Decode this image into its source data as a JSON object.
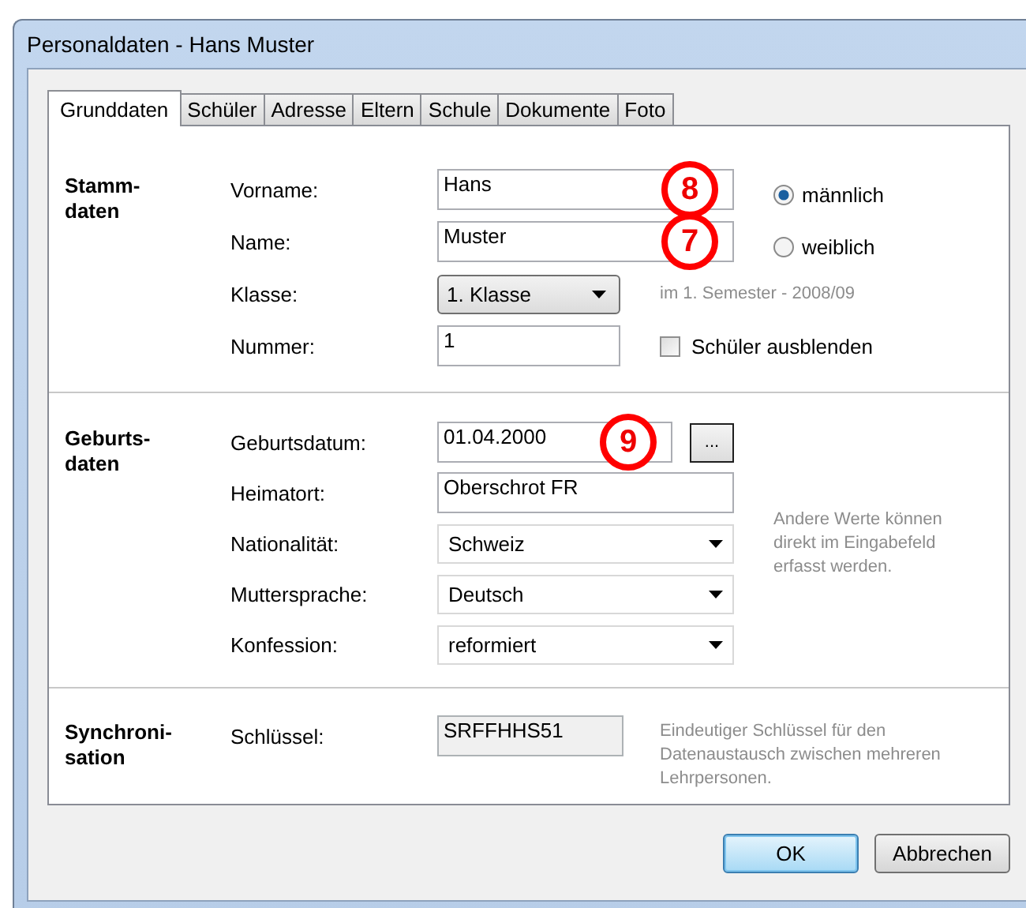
{
  "window": {
    "title": "Personaldaten - Hans Muster"
  },
  "tabs": [
    {
      "label": "Grunddaten",
      "selected": true
    },
    {
      "label": "Schüler",
      "selected": false
    },
    {
      "label": "Adresse",
      "selected": false
    },
    {
      "label": "Eltern",
      "selected": false
    },
    {
      "label": "Schule",
      "selected": false
    },
    {
      "label": "Dokumente",
      "selected": false
    },
    {
      "label": "Foto",
      "selected": false
    }
  ],
  "sections": [
    {
      "title": "Stamm-daten",
      "fields": [
        {
          "label": "Vorname:",
          "kind": "text",
          "value": "Hans",
          "callout": "8",
          "extra": {
            "kind": "radio",
            "label": "männlich",
            "selected": true
          }
        },
        {
          "label": "Name:",
          "kind": "text",
          "value": "Muster",
          "callout": "7",
          "extra": {
            "kind": "radio",
            "label": "weiblich",
            "selected": false
          }
        },
        {
          "label": "Klasse:",
          "kind": "combo",
          "value": "1. Klasse",
          "extra": {
            "kind": "hint",
            "text": "im 1. Semester - 2008/09"
          }
        },
        {
          "label": "Nummer:",
          "kind": "number",
          "value": "1",
          "extra": {
            "kind": "checkbox",
            "label": "Schüler ausblenden",
            "checked": false
          }
        }
      ]
    },
    {
      "title": "Geburts-daten",
      "note": "Andere Werte können direkt im Eingabefeld erfasst werden.",
      "fields": [
        {
          "label": "Geburtsdatum:",
          "kind": "date",
          "value": "01.04.2000",
          "callout": "9",
          "extra": {
            "kind": "button",
            "label": "..."
          }
        },
        {
          "label": "Heimatort:",
          "kind": "text",
          "value": "Oberschrot FR"
        },
        {
          "label": "Nationalität:",
          "kind": "dropdown",
          "value": "Schweiz"
        },
        {
          "label": "Muttersprache:",
          "kind": "dropdown",
          "value": "Deutsch"
        },
        {
          "label": "Konfession:",
          "kind": "dropdown",
          "value": "reformiert"
        }
      ]
    },
    {
      "title": "Synchroni-sation",
      "note": "Eindeutiger Schlüssel für den Datenaustausch zwischen mehreren Lehrpersonen.",
      "fields": [
        {
          "label": "Schlüssel:",
          "kind": "readonly",
          "value": "SRFFHHS51"
        }
      ]
    }
  ],
  "buttons": [
    {
      "label": "OK",
      "default": true
    },
    {
      "label": "Abbrechen",
      "default": false
    }
  ]
}
